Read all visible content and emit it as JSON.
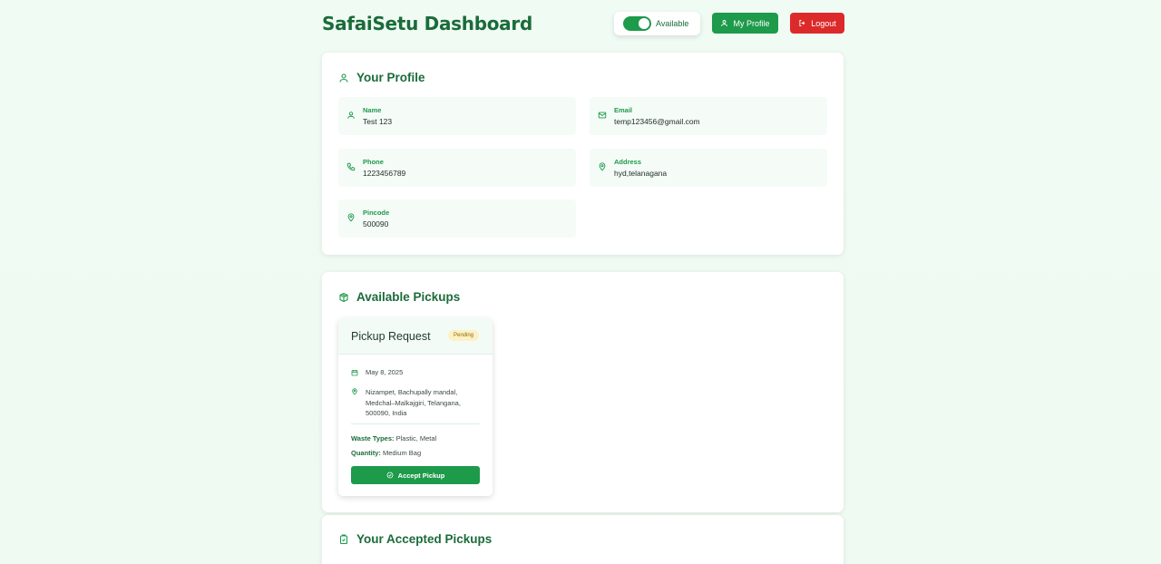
{
  "header": {
    "title": "SafaiSetu Dashboard",
    "availability_label": "Available",
    "profile_button": "My Profile",
    "logout_button": "Logout"
  },
  "profile": {
    "section_title": "Your Profile",
    "fields": [
      {
        "label": "Name",
        "value": "Test 123",
        "icon": "user-icon"
      },
      {
        "label": "Email",
        "value": "temp123456@gmail.com",
        "icon": "mail-icon"
      },
      {
        "label": "Phone",
        "value": "1223456789",
        "icon": "phone-icon"
      },
      {
        "label": "Address",
        "value": "hyd,telanagana",
        "icon": "map-pin-icon"
      },
      {
        "label": "Pincode",
        "value": "500090",
        "icon": "map-pin-icon"
      }
    ]
  },
  "pickups": {
    "section_title": "Available Pickups",
    "items": [
      {
        "title": "Pickup Request",
        "status": "Pending",
        "date": "May 8, 2025",
        "address": "Nizampet, Bachupally mandal, Medchal–Malkajgiri, Telangana, 500090, India",
        "waste_types_label": "Waste Types:",
        "waste_types": "Plastic, Metal",
        "quantity_label": "Quantity:",
        "quantity": "Medium Bag",
        "accept_label": "Accept Pickup"
      }
    ]
  },
  "accepted": {
    "section_title": "Your Accepted Pickups"
  },
  "colors": {
    "primary": "#1e9a4b",
    "danger": "#dc2a2a",
    "title": "#1b6b3a",
    "badge_bg": "#fdf1c4"
  }
}
